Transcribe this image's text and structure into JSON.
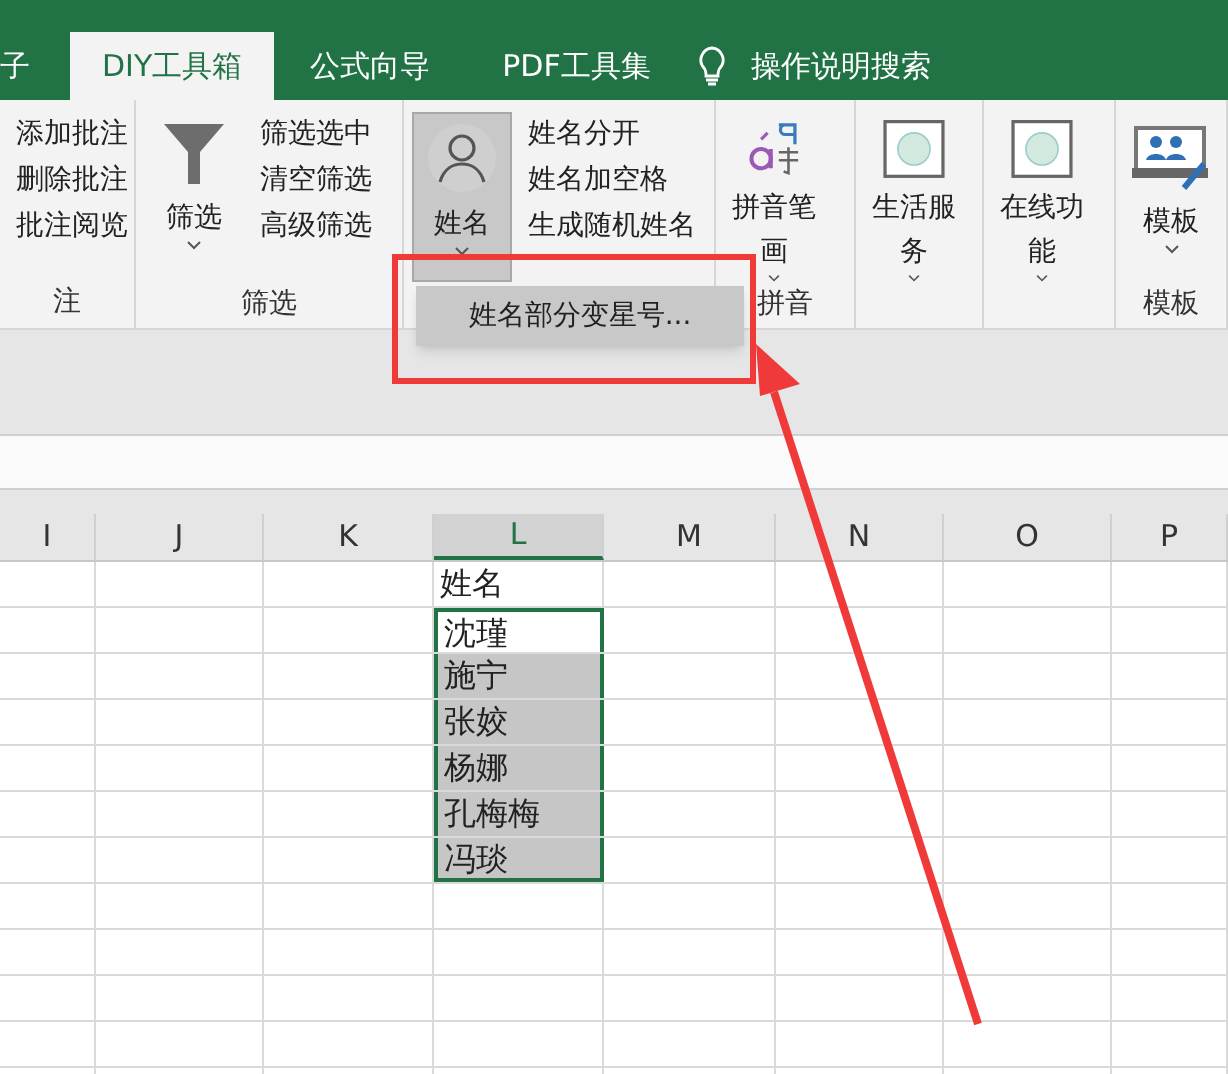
{
  "tabs": [
    {
      "label": "子",
      "selected": false
    },
    {
      "label": "DIY工具箱",
      "selected": true
    },
    {
      "label": "公式向导",
      "selected": false
    },
    {
      "label": "PDF工具集",
      "selected": false
    }
  ],
  "search": {
    "label": "操作说明搜索"
  },
  "ribbon_groups": [
    {
      "items": [
        "添加批注",
        "删除批注",
        "批注阅览"
      ],
      "label": "注"
    },
    {
      "large": {
        "kind": "funnel",
        "label": "筛选",
        "pressed": false
      },
      "items": [
        "筛选选中",
        "清空筛选",
        "高级筛选"
      ],
      "label": "筛选"
    },
    {
      "large": {
        "kind": "person",
        "label": "姓名",
        "pressed": true
      },
      "items": [
        "姓名分开",
        "姓名加空格",
        "生成随机姓名"
      ]
    },
    {
      "large": {
        "kind": "pinyin",
        "label": "拼音笔画",
        "pressed": false
      },
      "label": "拼音"
    },
    {
      "large": {
        "kind": "circle",
        "label": "生活服务",
        "pressed": false
      }
    },
    {
      "large": {
        "kind": "circle",
        "label": "在线功能",
        "pressed": false
      }
    },
    {
      "large": {
        "kind": "template",
        "label": "模板",
        "pressed": false
      },
      "label": "模板"
    }
  ],
  "menu": {
    "items": [
      "姓名部分变星号..."
    ]
  },
  "sheet": {
    "columns": [
      {
        "label": "I",
        "selected": false
      },
      {
        "label": "J",
        "selected": false
      },
      {
        "label": "K",
        "selected": false
      },
      {
        "label": "L",
        "selected": true
      },
      {
        "label": "M",
        "selected": false
      },
      {
        "label": "N",
        "selected": false
      },
      {
        "label": "O",
        "selected": false
      },
      {
        "label": "P",
        "selected": false
      }
    ],
    "rows": [
      {
        "L": "姓名",
        "selected": false
      },
      {
        "L": "沈瑾",
        "selected": true
      },
      {
        "L": "施宁",
        "selected": true
      },
      {
        "L": "张姣",
        "selected": true
      },
      {
        "L": "杨娜",
        "selected": true
      },
      {
        "L": "孔梅梅",
        "selected": true
      },
      {
        "L": "冯琰",
        "selected": true
      }
    ]
  }
}
